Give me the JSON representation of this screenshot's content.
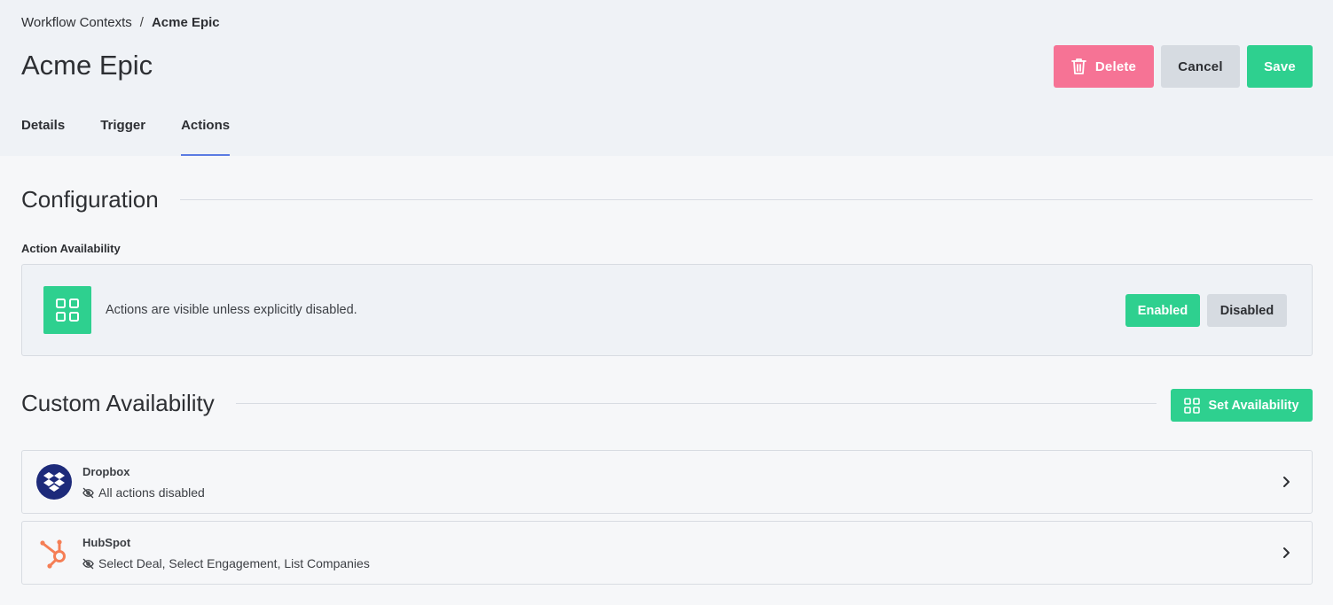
{
  "breadcrumb": {
    "parent": "Workflow Contexts",
    "separator": "/",
    "current": "Acme Epic"
  },
  "page_title": "Acme Epic",
  "header_actions": {
    "delete_label": "Delete",
    "cancel_label": "Cancel",
    "save_label": "Save"
  },
  "tabs": [
    {
      "label": "Details",
      "active": false
    },
    {
      "label": "Trigger",
      "active": false
    },
    {
      "label": "Actions",
      "active": true
    }
  ],
  "configuration": {
    "heading": "Configuration",
    "action_availability_label": "Action Availability",
    "availability_text": "Actions are visible unless explicitly disabled.",
    "enabled_label": "Enabled",
    "disabled_label": "Disabled",
    "selected": "Enabled"
  },
  "custom_availability": {
    "heading": "Custom Availability",
    "set_button_label": "Set Availability",
    "integrations": [
      {
        "name": "Dropbox",
        "status": "All actions disabled",
        "icon": "dropbox-logo"
      },
      {
        "name": "HubSpot",
        "status": "Select Deal, Select Engagement, List Companies",
        "icon": "hubspot-logo"
      }
    ]
  },
  "colors": {
    "accent_green": "#2ed08f",
    "delete_pink": "#f67395",
    "tab_underline": "#5b7be2",
    "dropbox_blue": "#1d2a7a",
    "hubspot_orange": "#f57e55"
  }
}
